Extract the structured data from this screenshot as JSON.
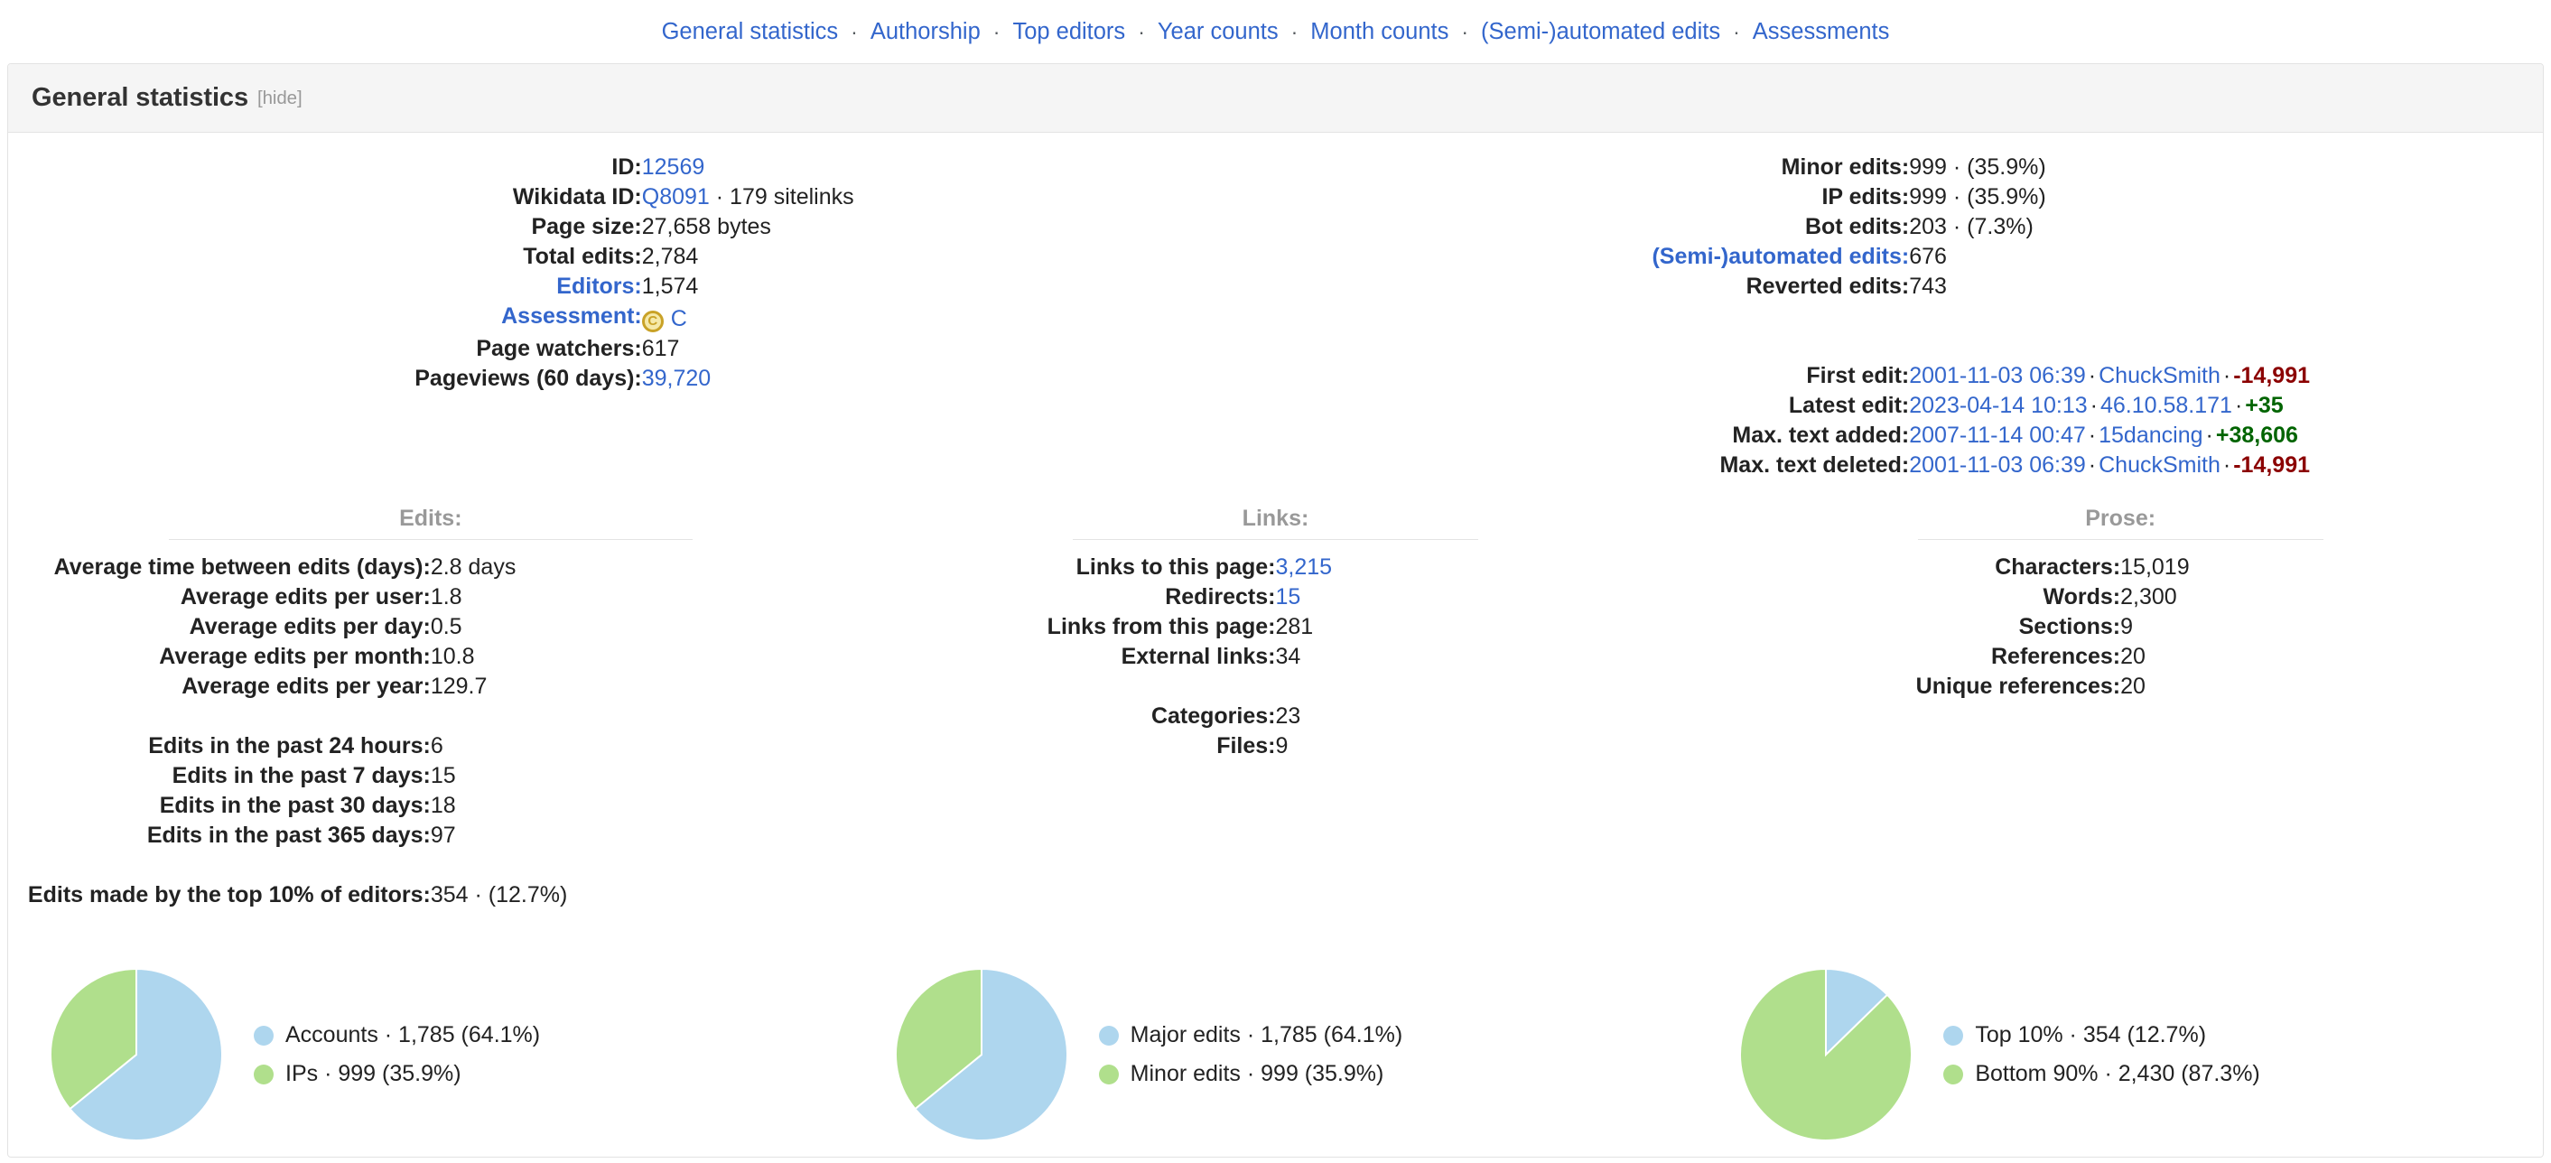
{
  "subnav": {
    "separator": "·",
    "items": [
      {
        "label": "General statistics"
      },
      {
        "label": "Authorship"
      },
      {
        "label": "Top editors"
      },
      {
        "label": "Year counts"
      },
      {
        "label": "Month counts"
      },
      {
        "label": "(Semi-)automated edits"
      },
      {
        "label": "Assessments"
      }
    ]
  },
  "panel": {
    "title": "General statistics",
    "hide_label": "[hide]"
  },
  "colors": {
    "link": "#3366cc",
    "pie_blue": "#aed6ee",
    "pie_green": "#b0df8c",
    "positive": "#006400",
    "negative": "#8b0000",
    "badge_gold": "#c9a227"
  },
  "basic_left": [
    {
      "label": "ID:",
      "value": "12569",
      "value_link": true,
      "label_link": false
    },
    {
      "label": "Wikidata ID:",
      "value": "Q8091",
      "value_link": true,
      "label_link": false,
      "suffix": "· 179 sitelinks"
    },
    {
      "label": "Page size:",
      "value": "27,658 bytes",
      "value_link": false,
      "label_link": false
    },
    {
      "label": "Total edits:",
      "value": "2,784",
      "value_link": false,
      "label_link": false
    },
    {
      "label": "Editors:",
      "value": "1,574",
      "value_link": false,
      "label_link": true
    },
    {
      "label": "Assessment:",
      "value": "C",
      "badge": "C",
      "value_link": true,
      "label_link": true
    },
    {
      "label": "Page watchers:",
      "value": "617",
      "value_link": false,
      "label_link": false
    },
    {
      "label": "Pageviews (60 days):",
      "value": "39,720",
      "value_link": true,
      "label_link": false
    }
  ],
  "basic_right": [
    {
      "label": "Minor edits:",
      "value": "999 · (35.9%)",
      "label_link": false
    },
    {
      "label": "IP edits:",
      "value": "999 · (35.9%)",
      "label_link": false
    },
    {
      "label": "Bot edits:",
      "value": "203 · (7.3%)",
      "label_link": false
    },
    {
      "label": "(Semi-)automated edits:",
      "value": "676",
      "label_link": true
    },
    {
      "label": "Reverted edits:",
      "value": "743",
      "label_link": false
    }
  ],
  "edit_history": [
    {
      "label": "First edit:",
      "date": "2001-11-03 06:39",
      "user": "ChuckSmith",
      "delta": "-14,991",
      "delta_sign": "neg"
    },
    {
      "label": "Latest edit:",
      "date": "2023-04-14 10:13",
      "user": "46.10.58.171",
      "delta": "+35",
      "delta_sign": "pos"
    },
    {
      "label": "Max. text added:",
      "date": "2007-11-14 00:47",
      "user": "15dancing",
      "delta": "+38,606",
      "delta_sign": "pos"
    },
    {
      "label": "Max. text deleted:",
      "date": "2001-11-03 06:39",
      "user": "ChuckSmith",
      "delta": "-14,991",
      "delta_sign": "neg"
    }
  ],
  "edits_column": {
    "heading": "Edits:",
    "group1": [
      {
        "label": "Average time between edits (days):",
        "value": "2.8 days"
      },
      {
        "label": "Average edits per user:",
        "value": "1.8"
      },
      {
        "label": "Average edits per day:",
        "value": "0.5"
      },
      {
        "label": "Average edits per month:",
        "value": "10.8"
      },
      {
        "label": "Average edits per year:",
        "value": "129.7"
      }
    ],
    "group2": [
      {
        "label": "Edits in the past 24 hours:",
        "value": "6"
      },
      {
        "label": "Edits in the past 7 days:",
        "value": "15"
      },
      {
        "label": "Edits in the past 30 days:",
        "value": "18"
      },
      {
        "label": "Edits in the past 365 days:",
        "value": "97"
      }
    ],
    "group3": [
      {
        "label": "Edits made by the top 10% of editors:",
        "value": "354 · (12.7%)"
      }
    ]
  },
  "links_column": {
    "heading": "Links:",
    "group1": [
      {
        "label": "Links to this page:",
        "value": "3,215",
        "value_link": true
      },
      {
        "label": "Redirects:",
        "value": "15",
        "value_link": true
      },
      {
        "label": "Links from this page:",
        "value": "281",
        "value_link": false
      },
      {
        "label": "External links:",
        "value": "34",
        "value_link": false
      }
    ],
    "group2": [
      {
        "label": "Categories:",
        "value": "23",
        "value_link": false
      },
      {
        "label": "Files:",
        "value": "9",
        "value_link": false
      }
    ]
  },
  "prose_column": {
    "heading": "Prose:",
    "group1": [
      {
        "label": "Characters:",
        "value": "15,019"
      },
      {
        "label": "Words:",
        "value": "2,300"
      },
      {
        "label": "Sections:",
        "value": "9"
      },
      {
        "label": "References:",
        "value": "20"
      },
      {
        "label": "Unique references:",
        "value": "20"
      }
    ]
  },
  "chart_data": [
    {
      "type": "pie",
      "name": "editor-types",
      "title": "",
      "legend_position": "right",
      "categories": [
        "Accounts",
        "IPs"
      ],
      "values": [
        1785,
        999
      ],
      "percentages": [
        64.1,
        35.9
      ],
      "colors": [
        "#aed6ee",
        "#b0df8c"
      ],
      "legend_labels": [
        "Accounts · 1,785 (64.1%)",
        "IPs · 999 (35.9%)"
      ]
    },
    {
      "type": "pie",
      "name": "edit-significance",
      "title": "",
      "legend_position": "right",
      "categories": [
        "Major edits",
        "Minor edits"
      ],
      "values": [
        1785,
        999
      ],
      "percentages": [
        64.1,
        35.9
      ],
      "colors": [
        "#aed6ee",
        "#b0df8c"
      ],
      "legend_labels": [
        "Major edits · 1,785 (64.1%)",
        "Minor edits · 999 (35.9%)"
      ]
    },
    {
      "type": "pie",
      "name": "editor-distribution",
      "title": "",
      "legend_position": "right",
      "categories": [
        "Top 10%",
        "Bottom 90%"
      ],
      "values": [
        354,
        2430
      ],
      "percentages": [
        12.7,
        87.3
      ],
      "colors": [
        "#aed6ee",
        "#b0df8c"
      ],
      "legend_labels": [
        "Top 10% · 354 (12.7%)",
        "Bottom 90% · 2,430 (87.3%)"
      ]
    }
  ]
}
